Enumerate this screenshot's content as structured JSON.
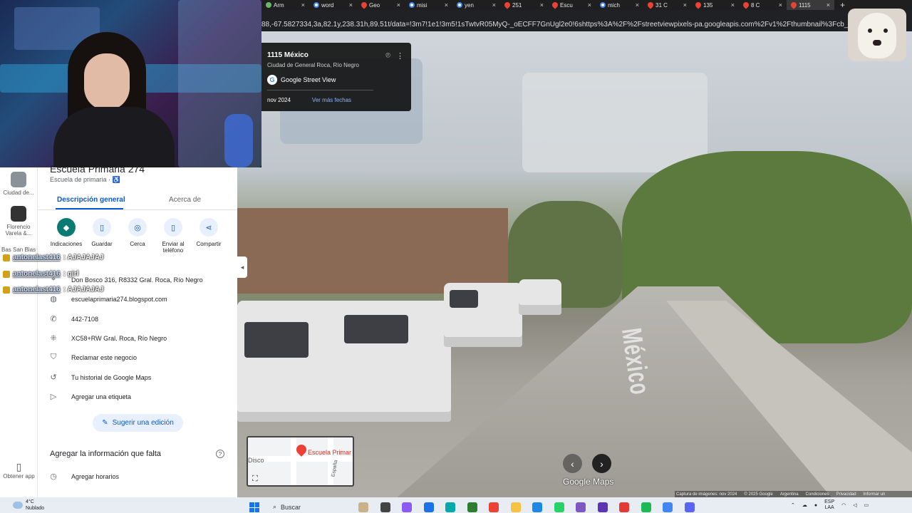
{
  "browser": {
    "tabs": [
      {
        "label": "Arm",
        "icon": "globe-icon"
      },
      {
        "label": "word",
        "icon": "google-icon"
      },
      {
        "label": "Geo",
        "icon": "maps-pin-icon"
      },
      {
        "label": "misi",
        "icon": "google-icon"
      },
      {
        "label": "yen",
        "icon": "google-icon"
      },
      {
        "label": "251",
        "icon": "maps-pin-icon"
      },
      {
        "label": "Escu",
        "icon": "maps-pin-icon"
      },
      {
        "label": "mich",
        "icon": "google-icon"
      },
      {
        "label": "31 C",
        "icon": "maps-pin-icon"
      },
      {
        "label": "135",
        "icon": "maps-pin-icon"
      },
      {
        "label": "8 C",
        "icon": "maps-pin-icon"
      },
      {
        "label": "1115",
        "icon": "maps-pin-icon"
      }
    ],
    "url": "88,-67.5827334,3a,82.1y,238.31h,89.51t/data=!3m7!1e1!3m5!1sTwtvR05MyQ-_oECFF7GnUgl2e0!6shttps%3A%2F%2Fstreetviewpixels-pa.googleapis.com%2Fv1%2Fthumbnail%3Fcb_client%3Dmap..."
  },
  "location_card": {
    "title": "1115 México",
    "subtitle": "Ciudad de General Roca, Río Negro",
    "source": "Google Street View",
    "date": "nov 2024",
    "more_dates": "Ver más fechas"
  },
  "sidebar": {
    "items": [
      {
        "label": "Ciudad de..."
      },
      {
        "label": "Florencio Varela &..."
      },
      {
        "label": "Bas San Blas"
      }
    ],
    "get_app": "Obtener app"
  },
  "panel": {
    "place_name": "Escuela Primaria 274",
    "place_type": "Escuela de primaria · ♿",
    "tabs": [
      "Descripción general",
      "Acerca de"
    ],
    "actions": [
      {
        "label": "Indicaciones",
        "icon": "directions-icon"
      },
      {
        "label": "Guardar",
        "icon": "bookmark-icon"
      },
      {
        "label": "Cerca",
        "icon": "nearby-icon"
      },
      {
        "label": "Enviar al teléfono",
        "icon": "phone-send-icon"
      },
      {
        "label": "Compartir",
        "icon": "share-icon"
      }
    ],
    "info": [
      {
        "text": "Don Bosco 316, R8332 Gral. Roca, Río Negro",
        "icon": "location-pin-icon"
      },
      {
        "text": "escuelaprimaria274.blogspot.com",
        "icon": "globe-icon"
      },
      {
        "text": "442-7108",
        "icon": "phone-icon"
      },
      {
        "text": "XC58+RW Gral. Roca, Río Negro",
        "icon": "plus-code-icon"
      },
      {
        "text": "Reclamar este negocio",
        "icon": "shield-check-icon"
      },
      {
        "text": "Tu historial de Google Maps",
        "icon": "history-icon"
      },
      {
        "text": "Agregar una etiqueta",
        "icon": "label-icon"
      }
    ],
    "suggest_edit": "Sugerir una edición",
    "missing_title": "Agregar la información que falta",
    "add_hours": "Agregar horarios"
  },
  "chat": [
    {
      "user": "antonelast416",
      "msg": ": AJAJAJAJ"
    },
    {
      "user": "antonelast416",
      "msg": ": girl"
    },
    {
      "user": "antonelast416",
      "msg": ": AJAJAJAJ"
    }
  ],
  "streetview": {
    "road_label": "México",
    "logo": "Google Maps",
    "attribution": [
      "Captura de imágenes: nov 2024",
      "© 2025 Google",
      "Argentina",
      "Condiciones",
      "Privacidad",
      "Informar un"
    ]
  },
  "minimap": {
    "label_school": "Escuela Primar",
    "label_disco": "Disco",
    "label_street": "España"
  },
  "taskbar": {
    "weather_temp": "4°C",
    "weather_desc": "Nublado",
    "search": "Buscar",
    "lang": "ESP",
    "lang_sub": "LAA"
  }
}
